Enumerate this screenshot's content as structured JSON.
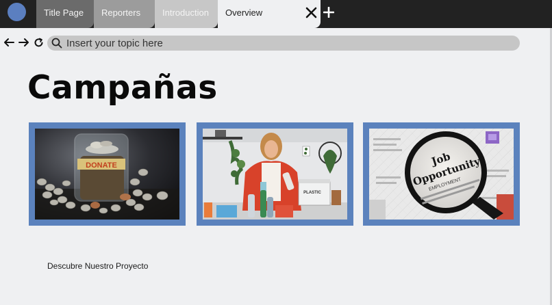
{
  "tabs": [
    {
      "label": "Title Page"
    },
    {
      "label": "Reporters"
    },
    {
      "label": "Introduction"
    },
    {
      "label": "Overview"
    }
  ],
  "search": {
    "placeholder": "Insert your topic here"
  },
  "page": {
    "title": "Campañas"
  },
  "cards": [
    {
      "image": "donation-jar-coins",
      "jar_label": "DONATE"
    },
    {
      "image": "woman-recycling-bottles",
      "bin_label": "PLASTIC"
    },
    {
      "image": "job-opportunity-magnifier",
      "headline_1": "Job",
      "headline_2": "Opportunity",
      "headline_3": "EMPLOYMENT"
    }
  ],
  "link": {
    "label": "Descubre Nuestro Proyecto"
  },
  "colors": {
    "accent": "#5b82bd",
    "topbar": "#222222",
    "background": "#eff0f2"
  }
}
